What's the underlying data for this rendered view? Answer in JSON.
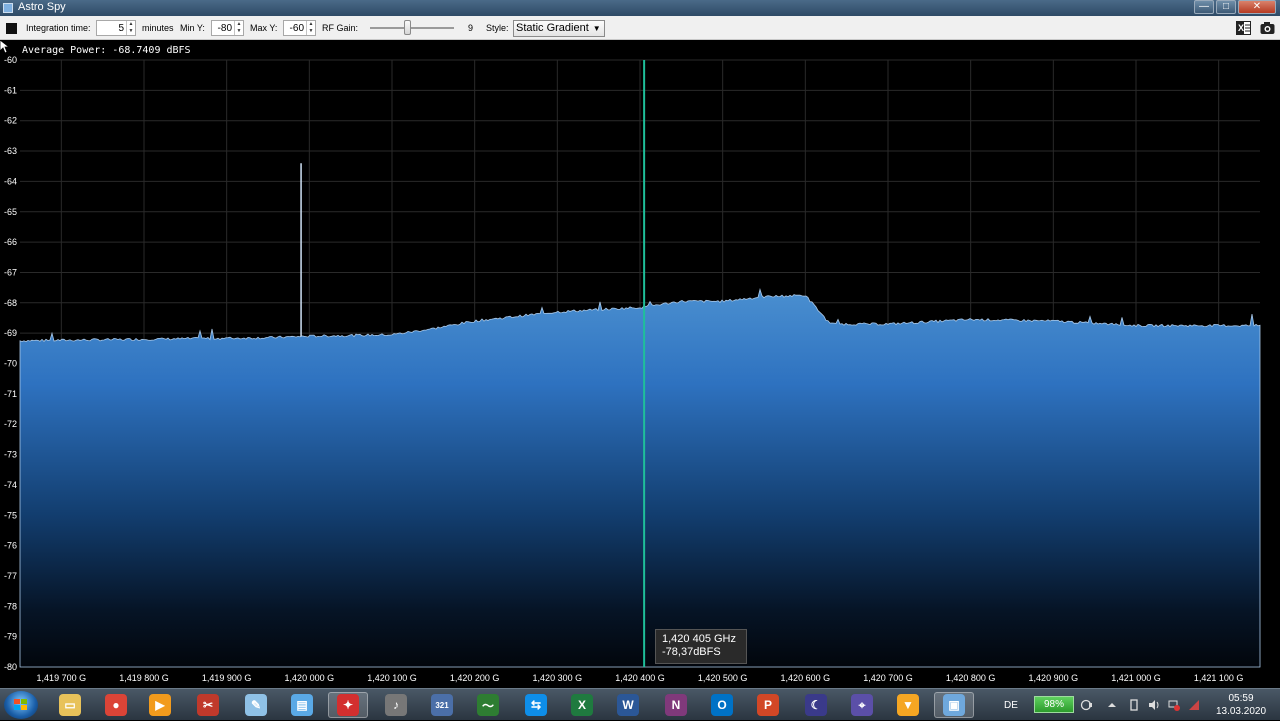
{
  "window": {
    "title": "Astro Spy"
  },
  "titlebar_buttons": {
    "minimize": "—",
    "maximize": "□",
    "close": "✕"
  },
  "toolbar": {
    "integration_label": "Integration time:",
    "integration_value": "5",
    "integration_unit": "minutes",
    "miny_label": "Min Y:",
    "miny_value": "-80",
    "maxy_label": "Max Y:",
    "maxy_value": "-60",
    "rfgain_label": "RF Gain:",
    "rfgain_value": "9",
    "rfgain_level_fraction": 0.43,
    "style_label": "Style:",
    "style_value": "Static Gradient",
    "icons": [
      "excel-export-icon",
      "camera-icon"
    ]
  },
  "chart_data": {
    "type": "area",
    "average_power_text": "Average Power: -68.7409 dBFS",
    "ylim": [
      -80,
      -60
    ],
    "yticks": [
      "-60",
      "-61",
      "-62",
      "-63",
      "-64",
      "-65",
      "-66",
      "-67",
      "-68",
      "-69",
      "-70",
      "-71",
      "-72",
      "-73",
      "-74",
      "-75",
      "-76",
      "-77",
      "-78",
      "-79",
      "-80"
    ],
    "xlim_ghz": [
      1.41965,
      1.42115
    ],
    "xticks": [
      {
        "v": 1.4197,
        "label": "1,419 700 G"
      },
      {
        "v": 1.4198,
        "label": "1,419 800 G"
      },
      {
        "v": 1.4199,
        "label": "1,419 900 G"
      },
      {
        "v": 1.42,
        "label": "1,420 000 G"
      },
      {
        "v": 1.4201,
        "label": "1,420 100 G"
      },
      {
        "v": 1.4202,
        "label": "1,420 200 G"
      },
      {
        "v": 1.4203,
        "label": "1,420 300 G"
      },
      {
        "v": 1.4204,
        "label": "1,420 400 G"
      },
      {
        "v": 1.4205,
        "label": "1,420 500 G"
      },
      {
        "v": 1.4206,
        "label": "1,420 600 G"
      },
      {
        "v": 1.4207,
        "label": "1,420 700 G"
      },
      {
        "v": 1.4208,
        "label": "1,420 800 G"
      },
      {
        "v": 1.4209,
        "label": "1,420 900 G"
      },
      {
        "v": 1.421,
        "label": "1,421 000 G"
      },
      {
        "v": 1.4211,
        "label": "1,421 100 G"
      }
    ],
    "series": [
      {
        "x": [
          1.41965,
          1.4198,
          1.41995,
          1.42,
          1.4201,
          1.42015,
          1.4202,
          1.4203,
          1.4204,
          1.42045,
          1.4205,
          1.42055,
          1.4206,
          1.42063,
          1.4207,
          1.4208,
          1.4209,
          1.421,
          1.4211,
          1.42115
        ],
        "y": [
          -69.25,
          -69.2,
          -69.15,
          -69.1,
          -69.05,
          -68.85,
          -68.6,
          -68.3,
          -68.15,
          -67.95,
          -67.95,
          -67.8,
          -67.75,
          -68.7,
          -68.7,
          -68.55,
          -68.6,
          -68.75,
          -68.75,
          -68.75
        ]
      }
    ],
    "spike": {
      "x": 1.41999,
      "y": -63.4
    },
    "cursor": {
      "x": 1.420405,
      "freq_text": "1,420 405 GHz",
      "value_text": "-78,37dBFS"
    }
  },
  "taskbar": {
    "apps": [
      {
        "name": "file-explorer-icon",
        "glyph": "▭",
        "color": "#e8c25a"
      },
      {
        "name": "chrome-icon",
        "glyph": "●",
        "color": "#db4437"
      },
      {
        "name": "media-player-icon",
        "glyph": "▶",
        "color": "#f29b1d"
      },
      {
        "name": "snipping-tool-icon",
        "glyph": "✂",
        "color": "#c0392b"
      },
      {
        "name": "paint-icon",
        "glyph": "✎",
        "color": "#8fc1e6"
      },
      {
        "name": "notepad-icon",
        "glyph": "▤",
        "color": "#5aa9e6"
      },
      {
        "name": "astro-spy-icon",
        "glyph": "✦",
        "color": "#d32f2f"
      },
      {
        "name": "microphone-icon",
        "glyph": "♪",
        "color": "#777777"
      },
      {
        "name": "video-editor-icon",
        "glyph": "321",
        "color": "#4b6fa8"
      },
      {
        "name": "resource-monitor-icon",
        "glyph": "〜",
        "color": "#2e7d32"
      },
      {
        "name": "teamviewer-icon",
        "glyph": "⇆",
        "color": "#0e8ee9"
      },
      {
        "name": "excel-icon",
        "glyph": "X",
        "color": "#1f7a3f"
      },
      {
        "name": "word-icon",
        "glyph": "W",
        "color": "#2b5797"
      },
      {
        "name": "onenote-icon",
        "glyph": "N",
        "color": "#80397b"
      },
      {
        "name": "outlook-icon",
        "glyph": "O",
        "color": "#0072c6"
      },
      {
        "name": "powerpoint-icon",
        "glyph": "P",
        "color": "#d24726"
      },
      {
        "name": "stellarium-icon",
        "glyph": "☾",
        "color": "#3a3a8a"
      },
      {
        "name": "satellite-icon",
        "glyph": "⌖",
        "color": "#5b4fa8"
      },
      {
        "name": "browser-icon",
        "glyph": "▼",
        "color": "#f5a623"
      },
      {
        "name": "monitor-app-icon",
        "glyph": "▣",
        "color": "#6fa8dc"
      }
    ],
    "lang": "DE",
    "battery": "98%",
    "time": "05:59",
    "date": "13.03.2020"
  }
}
